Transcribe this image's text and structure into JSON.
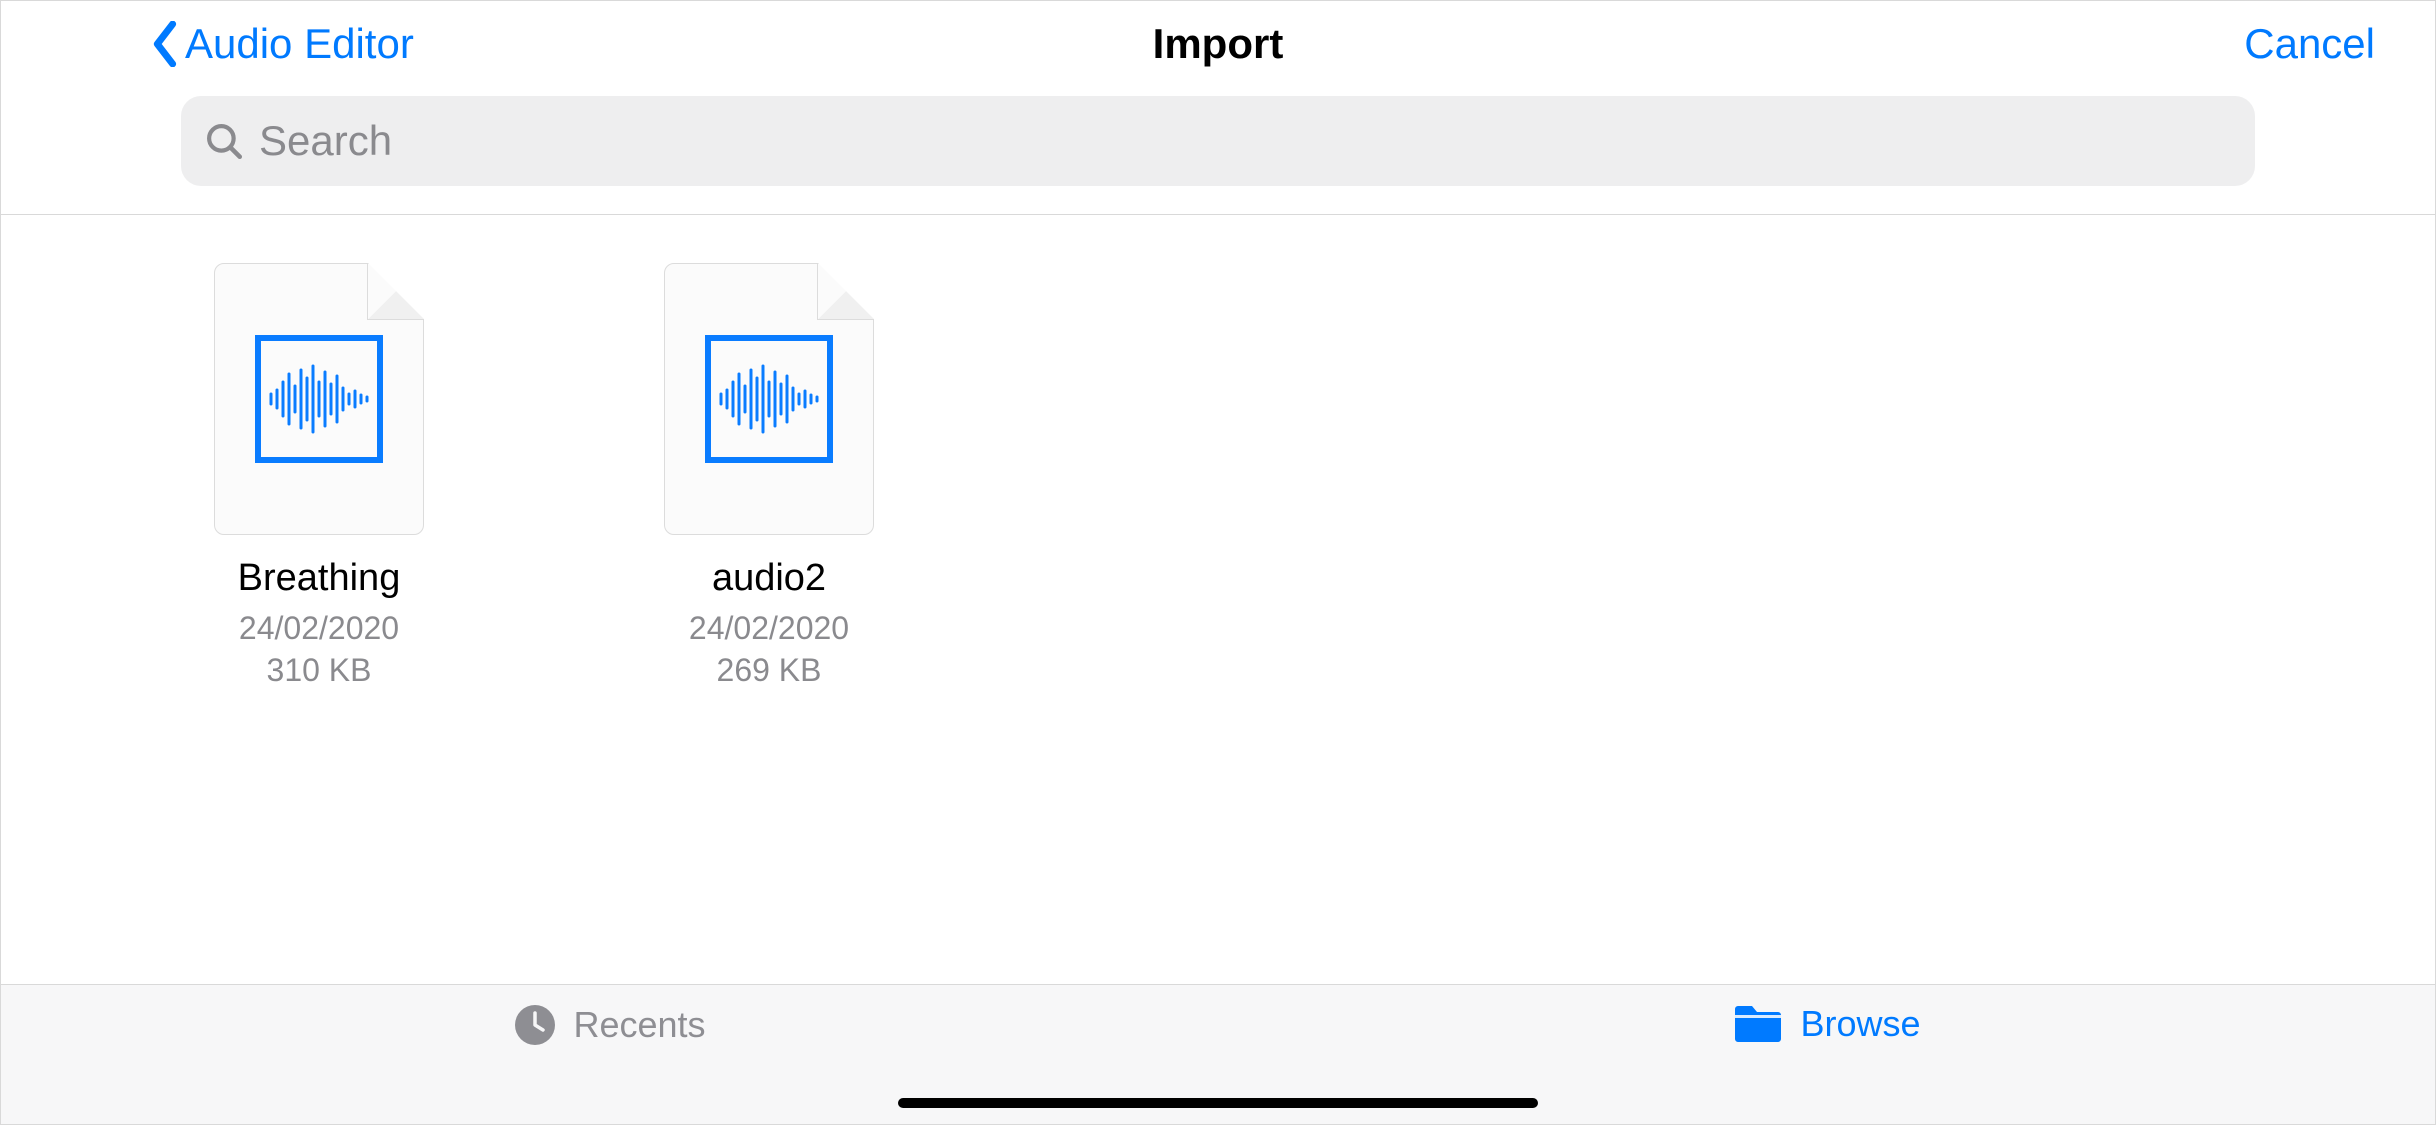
{
  "nav": {
    "back_label": "Audio Editor",
    "title": "Import",
    "cancel_label": "Cancel"
  },
  "search": {
    "placeholder": "Search"
  },
  "files": [
    {
      "name": "Breathing",
      "date": "24/02/2020",
      "size": "310 KB"
    },
    {
      "name": "audio2",
      "date": "24/02/2020",
      "size": "269 KB"
    }
  ],
  "tabs": {
    "recents_label": "Recents",
    "browse_label": "Browse"
  }
}
